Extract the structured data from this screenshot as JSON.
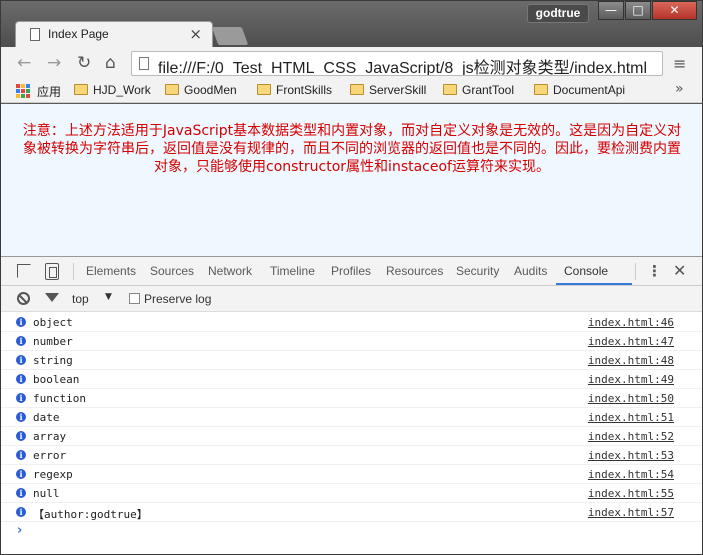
{
  "browser": {
    "tab_title": "Index Page",
    "tab_close": "×",
    "profile_name": "godtrue",
    "url": "file:///F:/0_Test_HTML_CSS_JavaScript/8_js检测对象类型/index.html",
    "window_controls": {
      "minimize": "—",
      "maximize": "□",
      "close": "✕"
    },
    "nav": {
      "back": "←",
      "forward": "→",
      "reload": "↻",
      "home": "⌂",
      "menu": "≡"
    }
  },
  "bookmarks": {
    "apps_label": "应用",
    "items": [
      "HJD_Work",
      "GoodMen",
      "FrontSkills",
      "ServerSkill",
      "GrantTool",
      "DocumentApi"
    ],
    "more": "»"
  },
  "page": {
    "notice": "注意：上述方法适用于JavaScript基本数据类型和内置对象，而对自定义对象是无效的。这是因为自定义对象被转换为字符串后，返回值是没有规律的，而且不同的浏览器的返回值也是不同的。因此，要检测费内置对象，只能够使用constructor属性和instaceof运算符来实现。"
  },
  "devtools": {
    "tabs": [
      "Elements",
      "Sources",
      "Network",
      "Timeline",
      "Profiles",
      "Resources",
      "Security",
      "Audits",
      "Console"
    ],
    "active_tab": "Console",
    "more": "⋮",
    "close": "✕",
    "context": "top",
    "context_arrow": "▼",
    "preserve_log_label": "Preserve log",
    "prompt": "›",
    "accent": "#3879d9"
  },
  "console": {
    "messages": [
      {
        "text": "object",
        "source": "index.html:46"
      },
      {
        "text": "number",
        "source": "index.html:47"
      },
      {
        "text": "string",
        "source": "index.html:48"
      },
      {
        "text": "boolean",
        "source": "index.html:49"
      },
      {
        "text": "function",
        "source": "index.html:50"
      },
      {
        "text": "date",
        "source": "index.html:51"
      },
      {
        "text": "array",
        "source": "index.html:52"
      },
      {
        "text": "error",
        "source": "index.html:53"
      },
      {
        "text": "regexp",
        "source": "index.html:54"
      },
      {
        "text": "null",
        "source": "index.html:55"
      },
      {
        "text": "【author:godtrue】",
        "source": "index.html:57"
      }
    ],
    "info_icon": "i"
  },
  "colors": {
    "notice_text": "#d40000",
    "page_bg": "#f0f8ff",
    "info_icon": "#2a5bd7"
  }
}
